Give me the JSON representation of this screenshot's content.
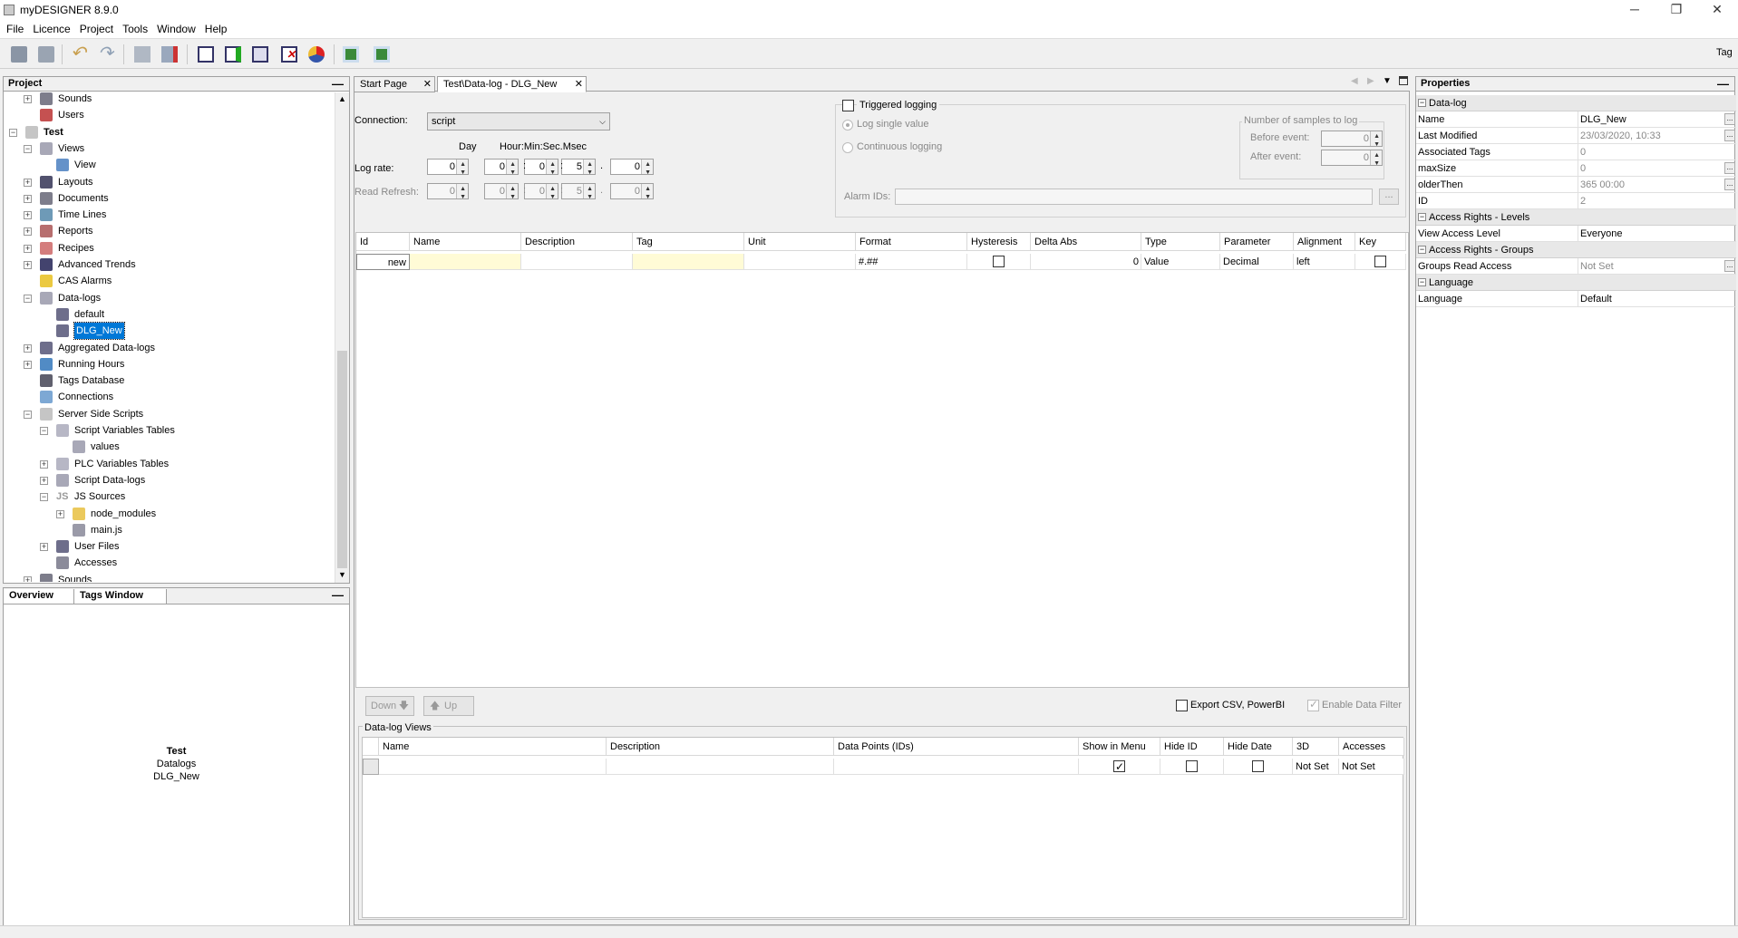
{
  "window": {
    "title": "myDESIGNER 8.9.0",
    "min": "─",
    "max": "❐",
    "close": "✕"
  },
  "menu": [
    "File",
    "Licence",
    "Project",
    "Tools",
    "Window",
    "Help"
  ],
  "toolbar": {
    "right_label": "Tag"
  },
  "project_panel": {
    "title": "Project",
    "tree": [
      {
        "label": "Sounds",
        "icon": "speaker-icon"
      },
      {
        "label": "Users",
        "icon": "users-icon"
      },
      {
        "label": "Test",
        "icon": "project-icon",
        "bold": true
      },
      {
        "label": "Views",
        "icon": "views-icon"
      },
      {
        "label": "View",
        "icon": "view-icon"
      },
      {
        "label": "Layouts",
        "icon": "layouts-icon"
      },
      {
        "label": "Documents",
        "icon": "documents-icon"
      },
      {
        "label": "Time Lines",
        "icon": "timeline-icon"
      },
      {
        "label": "Reports",
        "icon": "reports-icon"
      },
      {
        "label": "Recipes",
        "icon": "recipes-icon"
      },
      {
        "label": "Advanced Trends",
        "icon": "trend-icon"
      },
      {
        "label": "CAS Alarms",
        "icon": "alarm-icon"
      },
      {
        "label": "Data-logs",
        "icon": "datalog-icon"
      },
      {
        "label": "default",
        "icon": "datalog-item-icon"
      },
      {
        "label": "DLG_New",
        "icon": "datalog-item-icon"
      },
      {
        "label": "Aggregated Data-logs",
        "icon": "aggregated-icon"
      },
      {
        "label": "Running Hours",
        "icon": "clock-icon"
      },
      {
        "label": "Tags Database",
        "icon": "database-icon"
      },
      {
        "label": "Connections",
        "icon": "connection-icon"
      },
      {
        "label": "Server Side Scripts",
        "icon": "script-icon"
      },
      {
        "label": "Script Variables Tables",
        "icon": "table-icon"
      },
      {
        "label": "values",
        "icon": "values-icon"
      },
      {
        "label": "PLC Variables Tables",
        "icon": "table-icon"
      },
      {
        "label": "Script Data-logs",
        "icon": "datalog-icon"
      },
      {
        "label": "JS Sources",
        "icon": "js-icon"
      },
      {
        "label": "node_modules",
        "icon": "folder-icon"
      },
      {
        "label": "main.js",
        "icon": "file-icon"
      },
      {
        "label": "User Files",
        "icon": "userfiles-icon"
      },
      {
        "label": "Accesses",
        "icon": "key-icon"
      },
      {
        "label": "Sounds",
        "icon": "speaker-icon"
      }
    ]
  },
  "overview_panel": {
    "tabs": [
      "Overview",
      "Tags Window"
    ],
    "lines": [
      "Test",
      "Datalogs",
      "DLG_New"
    ]
  },
  "editor": {
    "tabs": [
      "Start Page",
      "Test\\Data-log - DLG_New"
    ],
    "connection_label": "Connection:",
    "connection_value": "script",
    "day_label": "Day",
    "time_label": "Hour:Min:Sec.Msec",
    "log_rate_label": "Log rate:",
    "log_rate": [
      "0",
      "0",
      "0",
      "5",
      "0"
    ],
    "read_refresh_label": "Read Refresh:",
    "read_refresh": [
      "0",
      "0",
      "0",
      "5",
      "0"
    ],
    "triggered_logging": "Triggered logging",
    "log_single": "Log single value",
    "continuous": "Continuous logging",
    "samples_group": "Number of samples to log",
    "before_event": "Before event:",
    "before_value": "0",
    "after_event": "After event:",
    "after_value": "0",
    "alarm_ids": "Alarm IDs:",
    "alarm_btn": "...",
    "grid_headers": [
      "Id",
      "Name",
      "Description",
      "Tag",
      "Unit",
      "Format",
      "Hysteresis",
      "Delta Abs",
      "Type",
      "Parameter",
      "Alignment",
      "Key"
    ],
    "grid_row": {
      "id": "new",
      "format": "#.##",
      "delta_abs": "0",
      "type": "Value",
      "parameter": "Decimal",
      "alignment": "left"
    },
    "down_btn": "Down",
    "up_btn": "Up",
    "export_csv": "Export CSV, PowerBI",
    "enable_filter": "Enable Data Filter",
    "views_title": "Data-log Views",
    "views_headers": [
      "Name",
      "Description",
      "Data Points (IDs)",
      "Show in Menu",
      "Hide ID",
      "Hide Date",
      "3D",
      "Accesses"
    ],
    "views_row": {
      "d3": "Not Set",
      "accesses": "Not Set"
    }
  },
  "properties": {
    "title": "Properties",
    "sections": [
      {
        "name": "Data-log",
        "rows": [
          {
            "k": "Name",
            "v": "DLG_New",
            "btn": true
          },
          {
            "k": "Last Modified",
            "v": "23/03/2020, 10:33",
            "btn": true,
            "dis": true
          },
          {
            "k": "Associated Tags",
            "v": "0",
            "dis": true
          },
          {
            "k": "maxSize",
            "v": "0",
            "btn": true,
            "dis": true
          },
          {
            "k": "olderThen",
            "v": "365 00:00",
            "btn": true,
            "dis": true
          },
          {
            "k": "ID",
            "v": "2",
            "dis": true
          }
        ]
      },
      {
        "name": "Access Rights - Levels",
        "rows": [
          {
            "k": "View Access Level",
            "v": "Everyone"
          }
        ]
      },
      {
        "name": "Access Rights - Groups",
        "rows": [
          {
            "k": "Groups Read Access",
            "v": "Not Set",
            "btn": true,
            "dis": true
          }
        ]
      },
      {
        "name": "Language",
        "rows": [
          {
            "k": "Language",
            "v": "Default"
          }
        ]
      }
    ]
  }
}
